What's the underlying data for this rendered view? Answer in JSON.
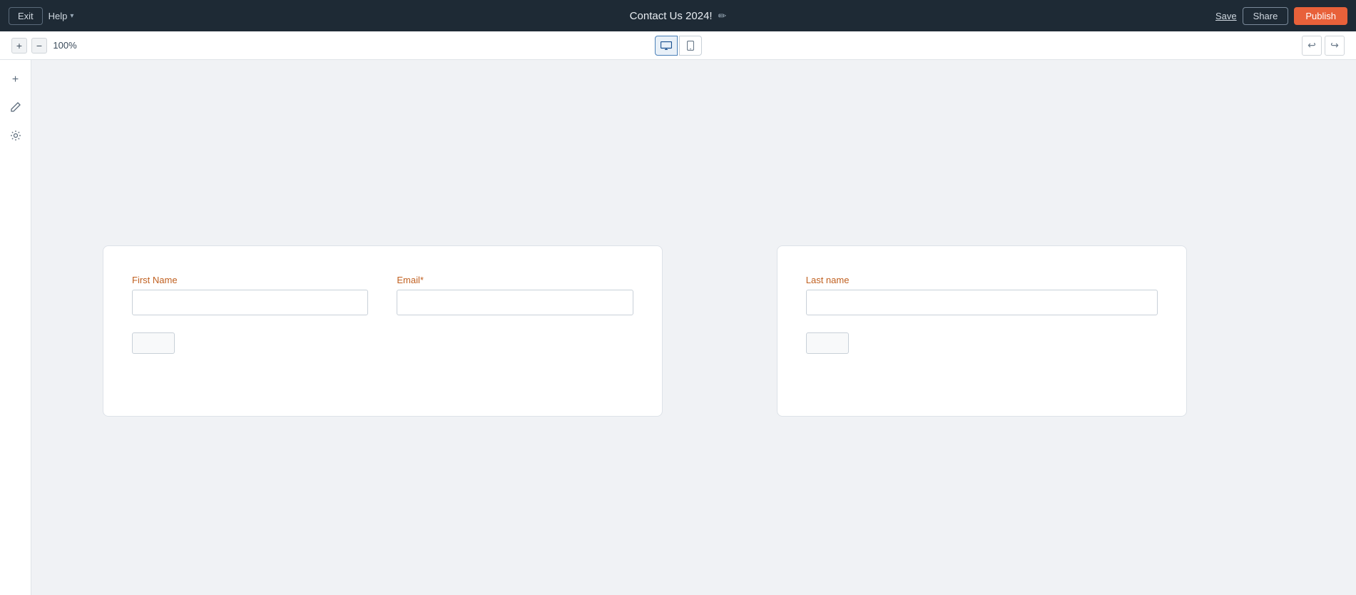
{
  "navbar": {
    "exit_label": "Exit",
    "help_label": "Help",
    "page_title": "Contact Us 2024!",
    "save_label": "Save",
    "share_label": "Share",
    "publish_label": "Publish"
  },
  "toolbar": {
    "zoom_level": "100%",
    "zoom_in_label": "+",
    "zoom_out_label": "−",
    "undo_label": "↩",
    "redo_label": "↪"
  },
  "sidebar": {
    "add_icon": "+",
    "edit_icon": "✏",
    "settings_icon": "⚙"
  },
  "form_card_1": {
    "field1_label": "First Name",
    "field1_placeholder": "",
    "field2_label": "Email*",
    "field2_placeholder": ""
  },
  "form_card_2": {
    "field1_label": "Last name",
    "field1_placeholder": ""
  }
}
